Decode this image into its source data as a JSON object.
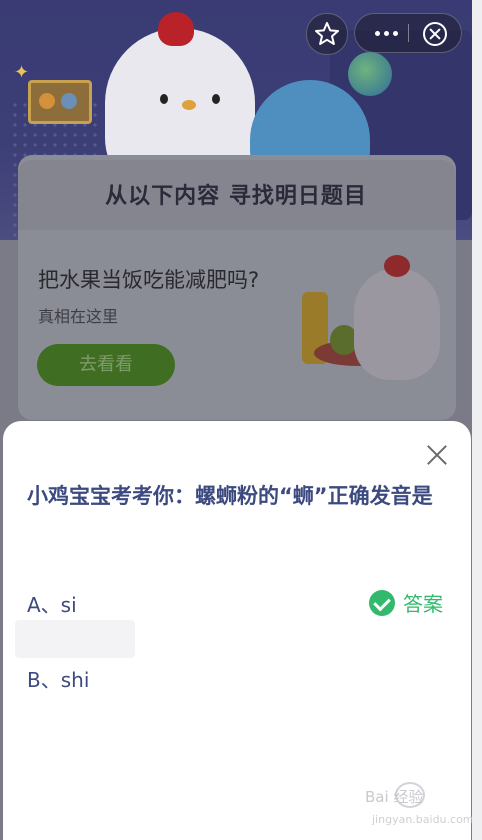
{
  "banner": {
    "title": "从以下内容 寻找明日题目"
  },
  "article": {
    "title": "把水果当饭吃能减肥吗?",
    "subtitle": "真相在这里",
    "button": "去看看"
  },
  "quiz": {
    "question": "小鸡宝宝考考你：螺蛳粉的“蛳”正确发音是",
    "options": [
      {
        "label": "A、si",
        "is_answer": true
      },
      {
        "label": "B、shi",
        "is_answer": false
      }
    ],
    "answer_label": "答案"
  },
  "watermark": {
    "text": "Bai 经验",
    "url": "jingyan.baidu.com"
  },
  "colors": {
    "question_text": "#3c4a80",
    "answer_green": "#32b96c",
    "button_green": "#3f6d22"
  },
  "icons": [
    "star-icon",
    "more-icon",
    "close-circle-icon",
    "close-icon",
    "check-icon"
  ]
}
